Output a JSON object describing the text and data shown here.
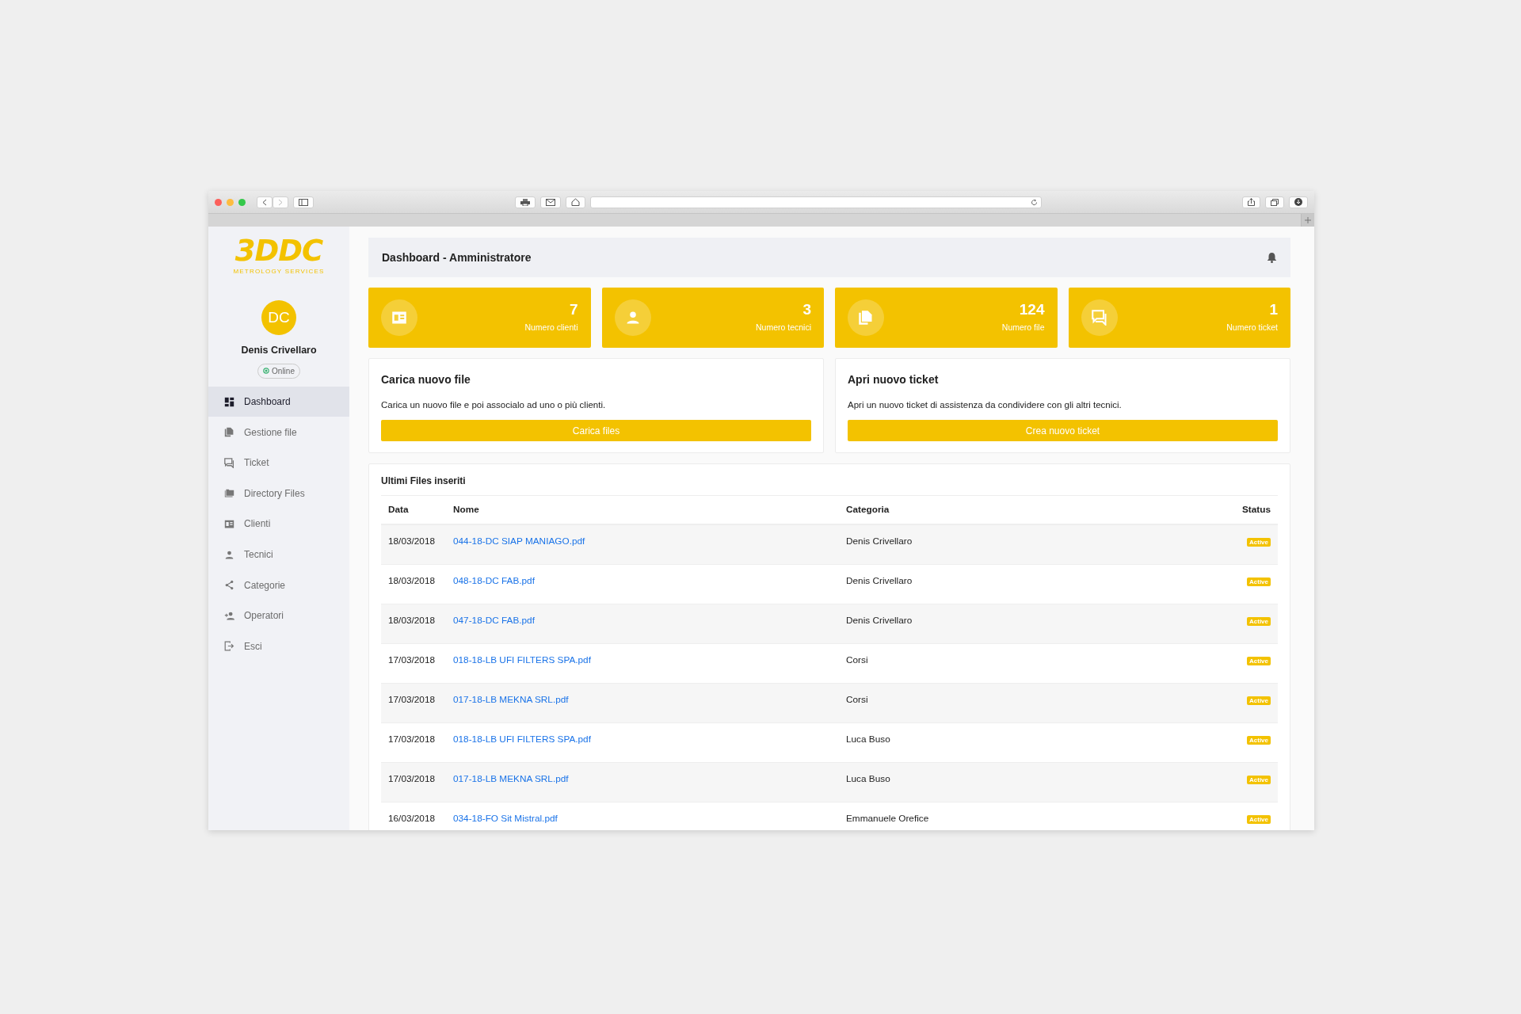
{
  "sidebar": {
    "logo": {
      "mark": "3DDC",
      "tagline": "METROLOGY SERVICES"
    },
    "user": {
      "initials": "DC",
      "name": "Denis Crivellaro",
      "status": "Online"
    },
    "items": [
      {
        "label": "Dashboard",
        "kind": "dashboard",
        "selected": true
      },
      {
        "label": "Gestione file",
        "kind": "file",
        "selected": false
      },
      {
        "label": "Ticket",
        "kind": "chat",
        "selected": false
      },
      {
        "label": "Directory Files",
        "kind": "folder",
        "selected": false
      },
      {
        "label": "Clienti",
        "kind": "card",
        "selected": false
      },
      {
        "label": "Tecnici",
        "kind": "person",
        "selected": false
      },
      {
        "label": "Categorie",
        "kind": "share",
        "selected": false
      },
      {
        "label": "Operatori",
        "kind": "person-add",
        "selected": false
      },
      {
        "label": "Esci",
        "kind": "exit",
        "selected": false
      }
    ]
  },
  "header": {
    "title": "Dashboard - Amministratore"
  },
  "stats": [
    {
      "value": "7",
      "label": "Numero clienti",
      "kind": "card"
    },
    {
      "value": "3",
      "label": "Numero tecnici",
      "kind": "person"
    },
    {
      "value": "124",
      "label": "Numero file",
      "kind": "file"
    },
    {
      "value": "1",
      "label": "Numero ticket",
      "kind": "chat"
    }
  ],
  "actions": [
    {
      "title": "Carica nuovo file",
      "text": "Carica un nuovo file e poi associalo ad uno o più clienti.",
      "button": "Carica files"
    },
    {
      "title": "Apri nuovo ticket",
      "text": "Apri un nuovo ticket di assistenza da condividere con gli altri tecnici.",
      "button": "Crea nuovo ticket"
    }
  ],
  "table": {
    "title": "Ultimi Files inseriti",
    "columns": [
      "Data",
      "Nome",
      "Categoria",
      "Status"
    ],
    "rows": [
      {
        "date": "18/03/2018",
        "name": "044-18-DC SIAP MANIAGO.pdf",
        "category": "Denis Crivellaro",
        "status": "Active"
      },
      {
        "date": "18/03/2018",
        "name": "048-18-DC FAB.pdf",
        "category": "Denis Crivellaro",
        "status": "Active"
      },
      {
        "date": "18/03/2018",
        "name": "047-18-DC FAB.pdf",
        "category": "Denis Crivellaro",
        "status": "Active"
      },
      {
        "date": "17/03/2018",
        "name": "018-18-LB UFI FILTERS SPA.pdf",
        "category": "Corsi",
        "status": "Active"
      },
      {
        "date": "17/03/2018",
        "name": "017-18-LB MEKNA SRL.pdf",
        "category": "Corsi",
        "status": "Active"
      },
      {
        "date": "17/03/2018",
        "name": "018-18-LB UFI FILTERS SPA.pdf",
        "category": "Luca Buso",
        "status": "Active"
      },
      {
        "date": "17/03/2018",
        "name": "017-18-LB MEKNA SRL.pdf",
        "category": "Luca Buso",
        "status": "Active"
      },
      {
        "date": "16/03/2018",
        "name": "034-18-FO Sit Mistral.pdf",
        "category": "Emmanuele Orefice",
        "status": "Active"
      }
    ]
  }
}
